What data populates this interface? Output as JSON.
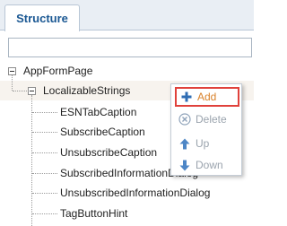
{
  "panel": {
    "tab_label": "Structure"
  },
  "search": {
    "value": "",
    "placeholder": ""
  },
  "tree": {
    "root": "AppFormPage",
    "group": "LocalizableStrings",
    "children": [
      "ESNTabCaption",
      "SubscribeCaption",
      "UnsubscribeCaption",
      "SubscribedInformationDialog",
      "UnsubscribedInformationDialog",
      "TagButtonHint"
    ]
  },
  "context_menu": {
    "items": [
      {
        "label": "Add",
        "icon": "plus-icon",
        "state": "active"
      },
      {
        "label": "Delete",
        "icon": "delete-icon",
        "state": "disabled"
      },
      {
        "label": "Up",
        "icon": "arrow-up-icon",
        "state": "disabled"
      },
      {
        "label": "Down",
        "icon": "arrow-down-icon",
        "state": "disabled"
      }
    ]
  },
  "colors": {
    "tab_text": "#1b5893",
    "highlight_border": "#e0413b",
    "add_text": "#d9822b",
    "disabled_text": "#9aa3ad",
    "selected_row_bg": "#f7f3ee"
  }
}
